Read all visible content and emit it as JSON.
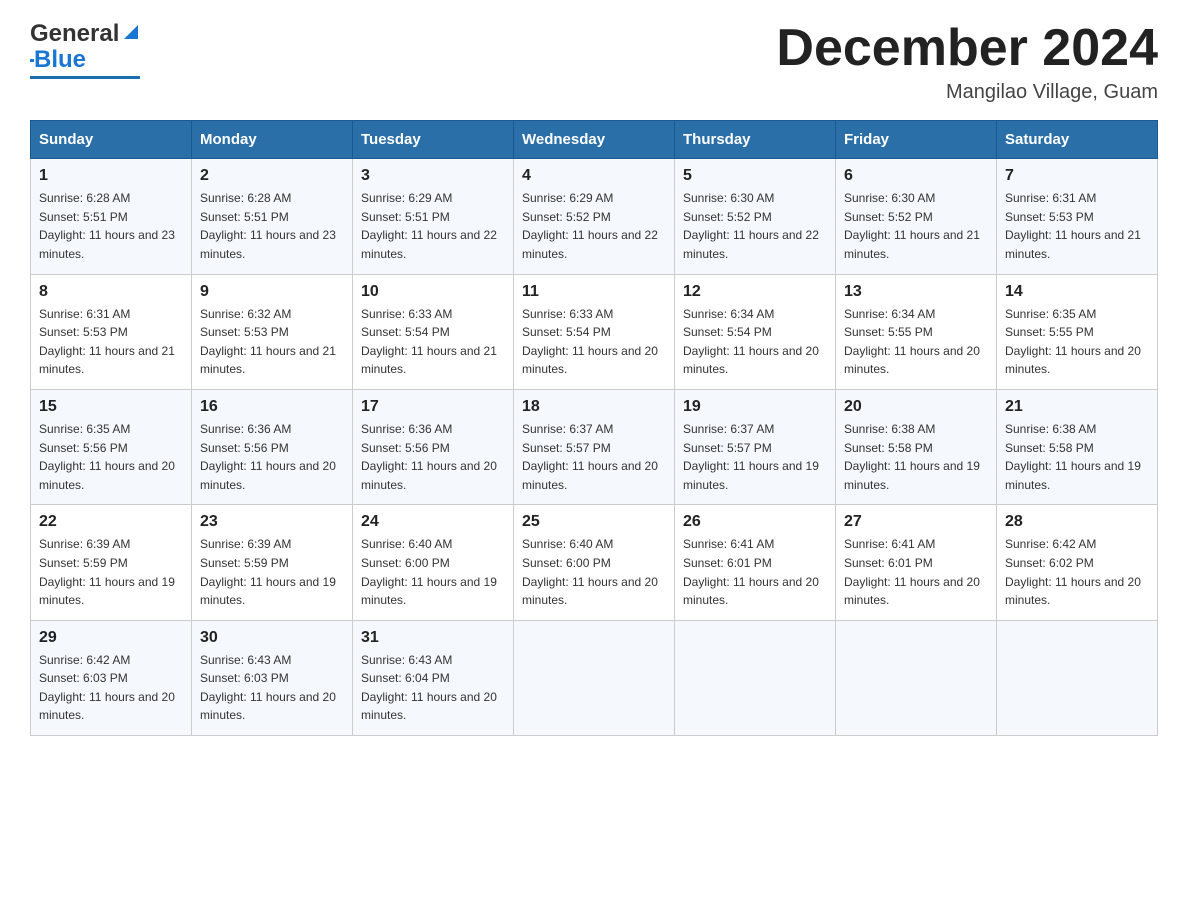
{
  "header": {
    "logo_general": "General",
    "logo_blue": "Blue",
    "title": "December 2024",
    "subtitle": "Mangilao Village, Guam"
  },
  "calendar": {
    "headers": [
      "Sunday",
      "Monday",
      "Tuesday",
      "Wednesday",
      "Thursday",
      "Friday",
      "Saturday"
    ],
    "weeks": [
      [
        {
          "day": "1",
          "sunrise": "6:28 AM",
          "sunset": "5:51 PM",
          "daylight": "11 hours and 23 minutes."
        },
        {
          "day": "2",
          "sunrise": "6:28 AM",
          "sunset": "5:51 PM",
          "daylight": "11 hours and 23 minutes."
        },
        {
          "day": "3",
          "sunrise": "6:29 AM",
          "sunset": "5:51 PM",
          "daylight": "11 hours and 22 minutes."
        },
        {
          "day": "4",
          "sunrise": "6:29 AM",
          "sunset": "5:52 PM",
          "daylight": "11 hours and 22 minutes."
        },
        {
          "day": "5",
          "sunrise": "6:30 AM",
          "sunset": "5:52 PM",
          "daylight": "11 hours and 22 minutes."
        },
        {
          "day": "6",
          "sunrise": "6:30 AM",
          "sunset": "5:52 PM",
          "daylight": "11 hours and 21 minutes."
        },
        {
          "day": "7",
          "sunrise": "6:31 AM",
          "sunset": "5:53 PM",
          "daylight": "11 hours and 21 minutes."
        }
      ],
      [
        {
          "day": "8",
          "sunrise": "6:31 AM",
          "sunset": "5:53 PM",
          "daylight": "11 hours and 21 minutes."
        },
        {
          "day": "9",
          "sunrise": "6:32 AM",
          "sunset": "5:53 PM",
          "daylight": "11 hours and 21 minutes."
        },
        {
          "day": "10",
          "sunrise": "6:33 AM",
          "sunset": "5:54 PM",
          "daylight": "11 hours and 21 minutes."
        },
        {
          "day": "11",
          "sunrise": "6:33 AM",
          "sunset": "5:54 PM",
          "daylight": "11 hours and 20 minutes."
        },
        {
          "day": "12",
          "sunrise": "6:34 AM",
          "sunset": "5:54 PM",
          "daylight": "11 hours and 20 minutes."
        },
        {
          "day": "13",
          "sunrise": "6:34 AM",
          "sunset": "5:55 PM",
          "daylight": "11 hours and 20 minutes."
        },
        {
          "day": "14",
          "sunrise": "6:35 AM",
          "sunset": "5:55 PM",
          "daylight": "11 hours and 20 minutes."
        }
      ],
      [
        {
          "day": "15",
          "sunrise": "6:35 AM",
          "sunset": "5:56 PM",
          "daylight": "11 hours and 20 minutes."
        },
        {
          "day": "16",
          "sunrise": "6:36 AM",
          "sunset": "5:56 PM",
          "daylight": "11 hours and 20 minutes."
        },
        {
          "day": "17",
          "sunrise": "6:36 AM",
          "sunset": "5:56 PM",
          "daylight": "11 hours and 20 minutes."
        },
        {
          "day": "18",
          "sunrise": "6:37 AM",
          "sunset": "5:57 PM",
          "daylight": "11 hours and 20 minutes."
        },
        {
          "day": "19",
          "sunrise": "6:37 AM",
          "sunset": "5:57 PM",
          "daylight": "11 hours and 19 minutes."
        },
        {
          "day": "20",
          "sunrise": "6:38 AM",
          "sunset": "5:58 PM",
          "daylight": "11 hours and 19 minutes."
        },
        {
          "day": "21",
          "sunrise": "6:38 AM",
          "sunset": "5:58 PM",
          "daylight": "11 hours and 19 minutes."
        }
      ],
      [
        {
          "day": "22",
          "sunrise": "6:39 AM",
          "sunset": "5:59 PM",
          "daylight": "11 hours and 19 minutes."
        },
        {
          "day": "23",
          "sunrise": "6:39 AM",
          "sunset": "5:59 PM",
          "daylight": "11 hours and 19 minutes."
        },
        {
          "day": "24",
          "sunrise": "6:40 AM",
          "sunset": "6:00 PM",
          "daylight": "11 hours and 19 minutes."
        },
        {
          "day": "25",
          "sunrise": "6:40 AM",
          "sunset": "6:00 PM",
          "daylight": "11 hours and 20 minutes."
        },
        {
          "day": "26",
          "sunrise": "6:41 AM",
          "sunset": "6:01 PM",
          "daylight": "11 hours and 20 minutes."
        },
        {
          "day": "27",
          "sunrise": "6:41 AM",
          "sunset": "6:01 PM",
          "daylight": "11 hours and 20 minutes."
        },
        {
          "day": "28",
          "sunrise": "6:42 AM",
          "sunset": "6:02 PM",
          "daylight": "11 hours and 20 minutes."
        }
      ],
      [
        {
          "day": "29",
          "sunrise": "6:42 AM",
          "sunset": "6:03 PM",
          "daylight": "11 hours and 20 minutes."
        },
        {
          "day": "30",
          "sunrise": "6:43 AM",
          "sunset": "6:03 PM",
          "daylight": "11 hours and 20 minutes."
        },
        {
          "day": "31",
          "sunrise": "6:43 AM",
          "sunset": "6:04 PM",
          "daylight": "11 hours and 20 minutes."
        },
        null,
        null,
        null,
        null
      ]
    ]
  },
  "colors": {
    "header_bg": "#2a6fa8",
    "header_text": "#ffffff",
    "accent_blue": "#1976d2",
    "border": "#cccccc",
    "row_odd": "#f5f9fd",
    "row_even": "#ffffff"
  }
}
